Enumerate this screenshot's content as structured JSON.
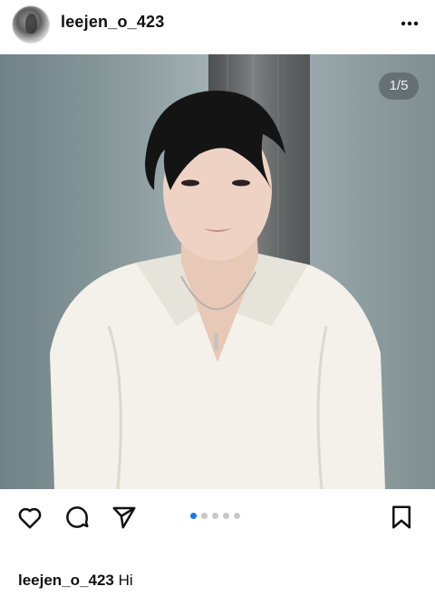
{
  "post": {
    "username": "leejen_o_423",
    "counter": "1/5",
    "caption_user": "leejen_o_423",
    "caption_text": "Hi",
    "carousel": {
      "total": 5,
      "active_index": 0
    }
  },
  "icons": {
    "more": "more-options-icon",
    "like": "heart-icon",
    "comment": "comment-icon",
    "share": "send-icon",
    "save": "bookmark-icon"
  },
  "colors": {
    "active_dot": "#1877f2",
    "inactive_dot": "#c8c8c8"
  }
}
